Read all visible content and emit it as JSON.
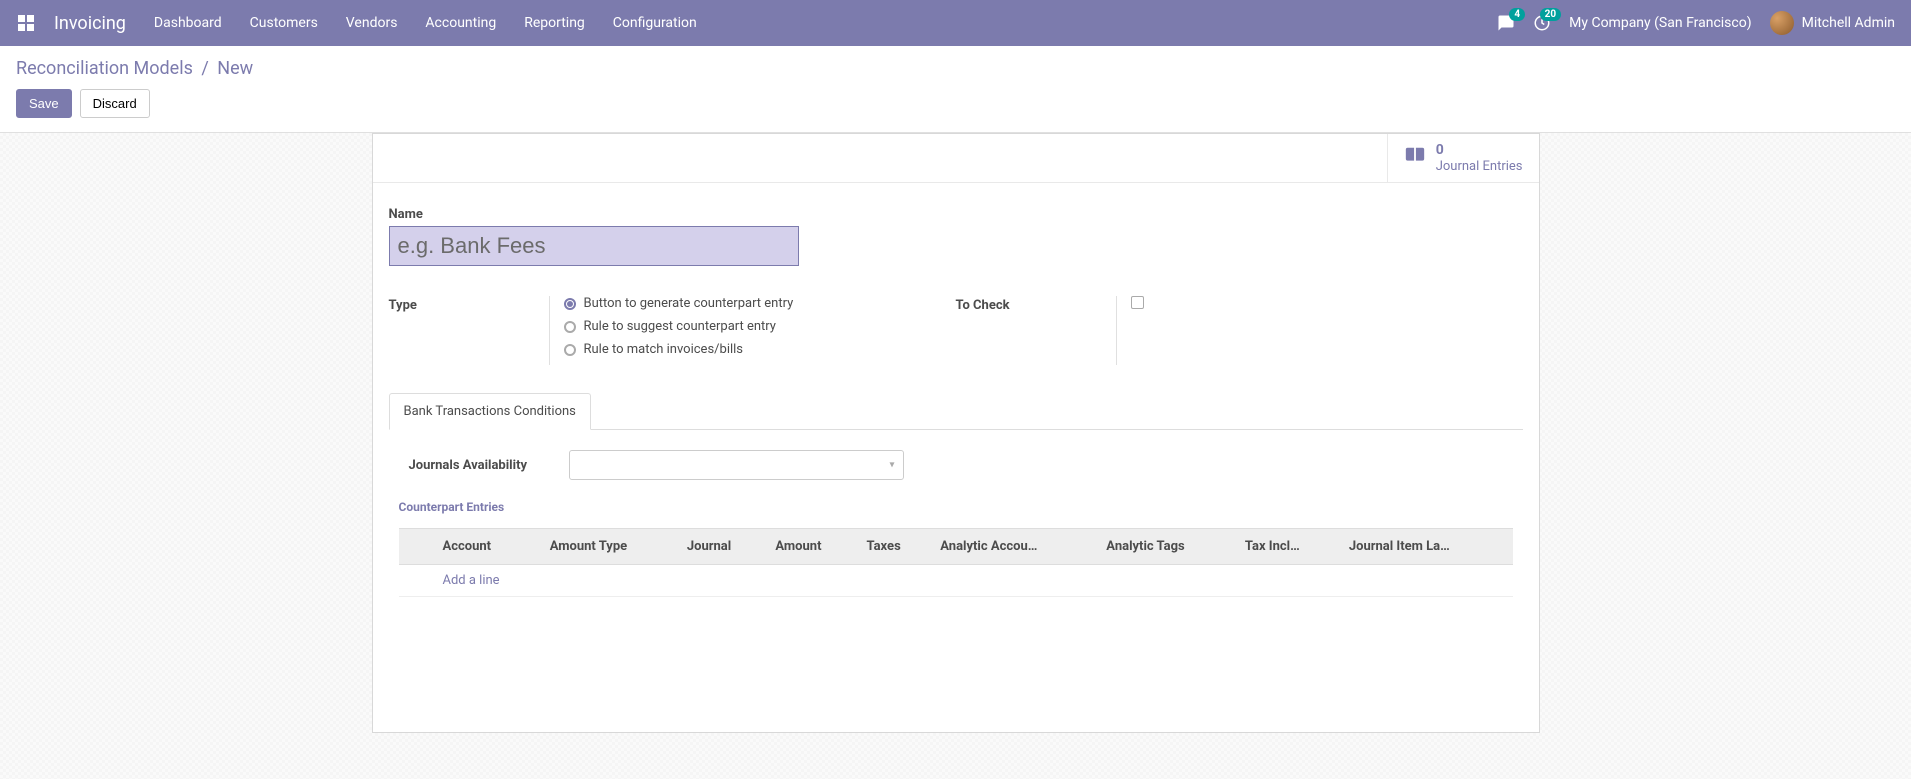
{
  "nav": {
    "brand": "Invoicing",
    "menu": [
      "Dashboard",
      "Customers",
      "Vendors",
      "Accounting",
      "Reporting",
      "Configuration"
    ],
    "messages_badge": "4",
    "activities_badge": "20",
    "company": "My Company (San Francisco)",
    "user": "Mitchell Admin"
  },
  "breadcrumb": {
    "parent": "Reconciliation Models",
    "current": "New"
  },
  "buttons": {
    "save": "Save",
    "discard": "Discard"
  },
  "stat": {
    "value": "0",
    "label": "Journal Entries"
  },
  "form": {
    "name_label": "Name",
    "name_placeholder": "e.g. Bank Fees",
    "type_label": "Type",
    "type_options": [
      "Button to generate counterpart entry",
      "Rule to suggest counterpart entry",
      "Rule to match invoices/bills"
    ],
    "to_check_label": "To Check",
    "tab_label": "Bank Transactions Conditions",
    "journals_label": "Journals Availability",
    "section_title": "Counterpart Entries",
    "columns": {
      "account": "Account",
      "amount_type": "Amount Type",
      "journal": "Journal",
      "amount": "Amount",
      "taxes": "Taxes",
      "analytic_account": "Analytic Accou…",
      "analytic_tags": "Analytic Tags",
      "tax_included": "Tax Incl…",
      "journal_item_label": "Journal Item La…"
    },
    "add_line": "Add a line"
  }
}
